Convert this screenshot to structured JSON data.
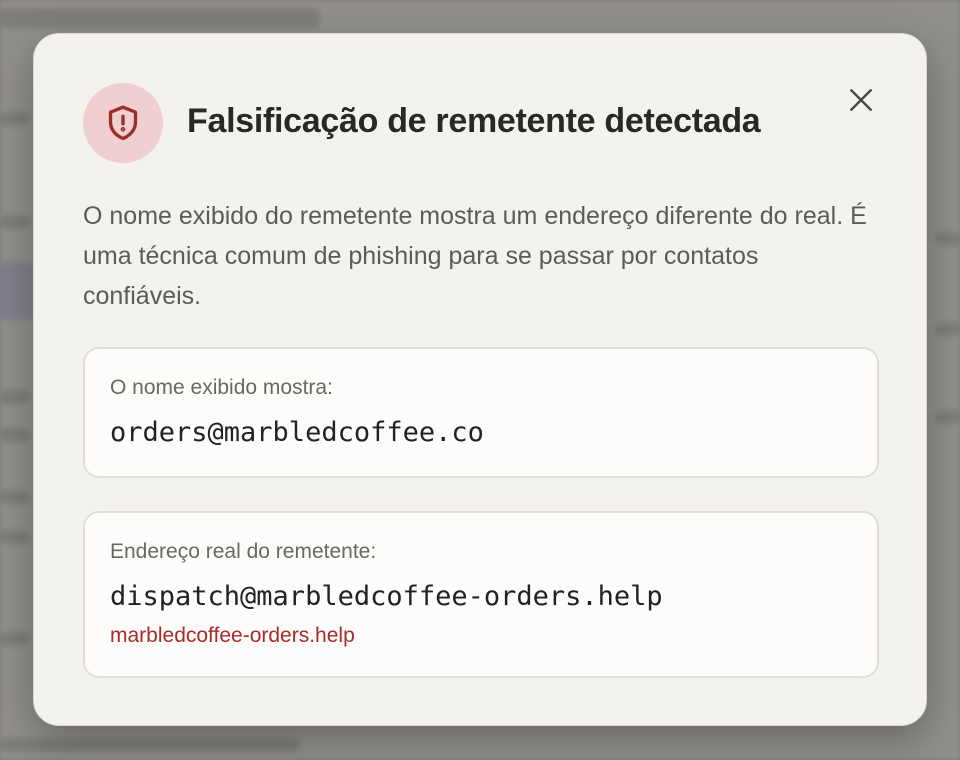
{
  "dialog": {
    "title": "Falsificação de remetente detectada",
    "description": "O nome exibido do remetente mostra um endereço diferente do real. É uma técnica comum de phishing para se passar por contatos confiáveis.",
    "icon": "shield-alert-icon",
    "close_icon": "close-icon",
    "displayed_name": {
      "label": "O nome exibido mostra:",
      "value": "orders@marbledcoffee.co"
    },
    "real_address": {
      "label": "Endereço real do remetente:",
      "value": "dispatch@marbledcoffee-orders.help",
      "domain": "marbledcoffee-orders.help"
    }
  },
  "colors": {
    "accent_danger": "#a62c28",
    "icon_background": "#efcfcf",
    "modal_background": "#f3f2ef",
    "card_background": "#fdfcfa"
  }
}
